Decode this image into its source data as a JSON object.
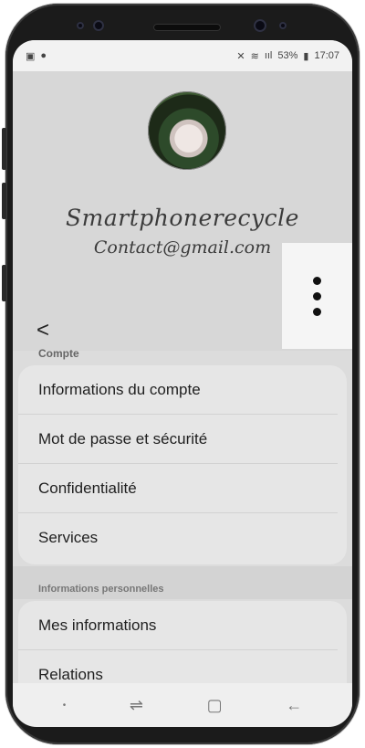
{
  "status_bar": {
    "left_icons": [
      "image-icon",
      "notification-icon"
    ],
    "mute_icon": "mute-icon",
    "wifi_icon": "wifi-icon",
    "signal_text": "ııl",
    "battery": "53%",
    "battery_icon": "battery-icon",
    "time": "17:07"
  },
  "profile": {
    "name": "Smartphonerecycle",
    "email": "Contact@gmail.com"
  },
  "header": {
    "back_label": "<"
  },
  "sections": [
    {
      "label": "Compte",
      "items": [
        {
          "label": "Informations du compte"
        },
        {
          "label": "Mot de passe et sécurité"
        },
        {
          "label": "Confidentialité"
        },
        {
          "label": "Services"
        }
      ]
    },
    {
      "label": "Informations personnelles",
      "items": [
        {
          "label": "Mes informations"
        },
        {
          "label": "Relations"
        }
      ]
    }
  ],
  "navbar": {
    "dot": "•",
    "recents": "⇌",
    "home": "▢",
    "back": "←"
  }
}
